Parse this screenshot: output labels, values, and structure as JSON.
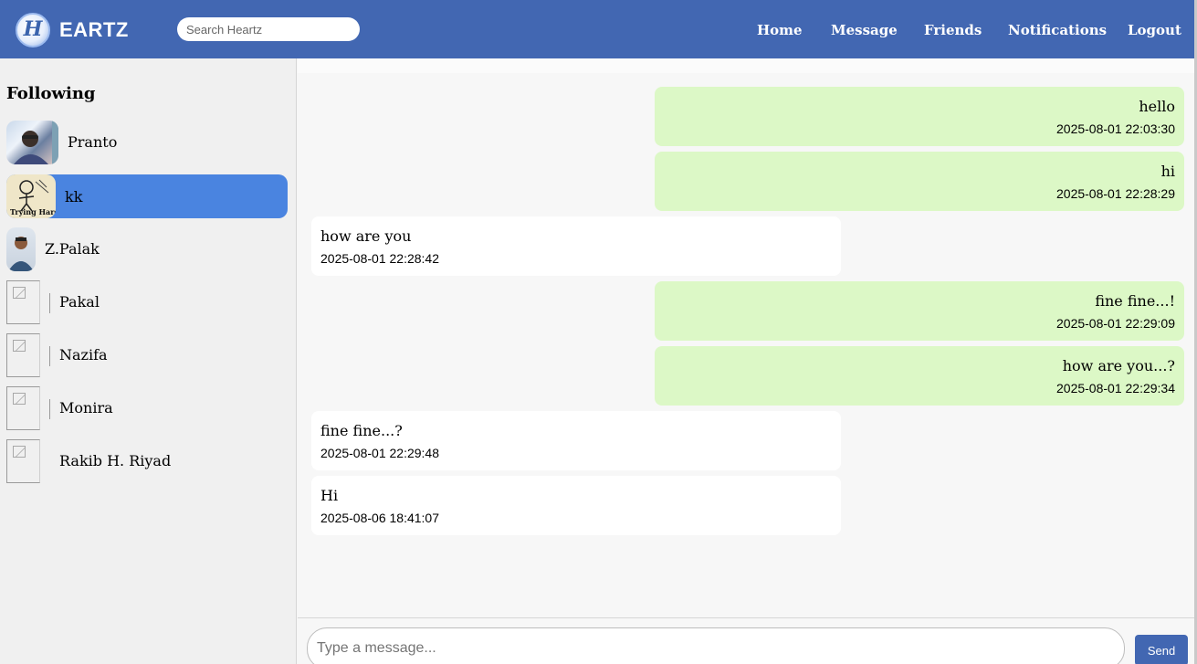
{
  "header": {
    "logo_letter": "H",
    "brand": "EARTZ",
    "search_placeholder": "Search Heartz",
    "nav": [
      "Home",
      "Message",
      "Friends",
      "Notifications",
      "Logout"
    ]
  },
  "sidebar": {
    "title": "Following",
    "friends": [
      {
        "name": "Pranto",
        "active": false,
        "avatar": "photo"
      },
      {
        "name": "kk",
        "active": true,
        "avatar": "photo",
        "avatar_caption": "Trying Hard"
      },
      {
        "name": "Z.Palak",
        "active": false,
        "avatar": "photo"
      },
      {
        "name": "Pakal",
        "active": false,
        "avatar": "broken-image"
      },
      {
        "name": "Nazifa",
        "active": false,
        "avatar": "broken-image"
      },
      {
        "name": "Monira",
        "active": false,
        "avatar": "broken-image"
      },
      {
        "name": "Rakib H. Riyad",
        "active": false,
        "avatar": "broken-image"
      }
    ]
  },
  "chat": {
    "messages": [
      {
        "direction": "sent",
        "text": "hello",
        "time": "2025-08-01 22:03:30"
      },
      {
        "direction": "sent",
        "text": "hi",
        "time": "2025-08-01 22:28:29"
      },
      {
        "direction": "received",
        "text": "how are you",
        "time": "2025-08-01 22:28:42"
      },
      {
        "direction": "sent",
        "text": "fine fine...!",
        "time": "2025-08-01 22:29:09"
      },
      {
        "direction": "sent",
        "text": "how are you...?",
        "time": "2025-08-01 22:29:34"
      },
      {
        "direction": "received",
        "text": "fine fine...?",
        "time": "2025-08-01 22:29:48"
      },
      {
        "direction": "received",
        "text": "Hi",
        "time": "2025-08-06 18:41:07"
      }
    ]
  },
  "composer": {
    "placeholder": "Type a message...",
    "send_label": "Send"
  },
  "colors": {
    "header": "#4267b2",
    "active_friend": "#4a84e0",
    "sent_bubble": "#dcf8c6",
    "received_bubble": "#ffffff"
  }
}
